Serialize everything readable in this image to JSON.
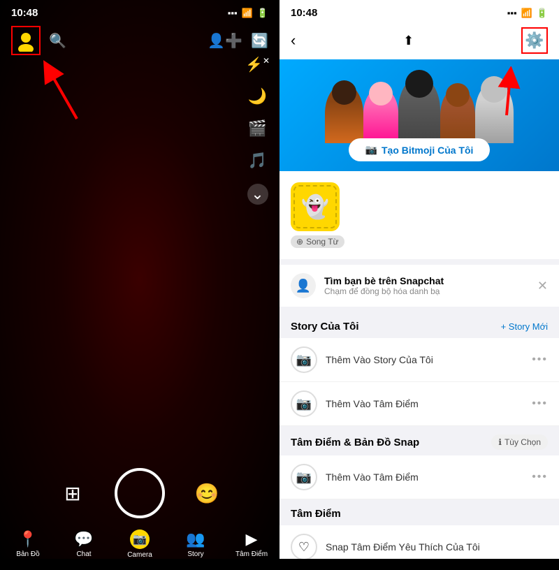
{
  "left": {
    "status_time": "10:48",
    "profile_icon": "👤",
    "top_right_icons": [
      "➕",
      "🔄"
    ],
    "side_icons": [
      "⚡",
      "🌙",
      "🎬",
      "🎵",
      "⌄"
    ],
    "bottom_nav": [
      {
        "label": "Bản Đồ",
        "icon": "📍"
      },
      {
        "label": "Chat",
        "icon": "💬"
      },
      {
        "label": "Camera",
        "icon": "📷",
        "active": true
      },
      {
        "label": "Story",
        "icon": "👥"
      },
      {
        "label": "Tâm Điểm",
        "icon": "▶"
      }
    ]
  },
  "right": {
    "status_time": "10:48",
    "bitmoji_create_btn": "Tạo Bitmoji Của Tôi",
    "username": "Song Từ",
    "find_friends_title": "Tìm bạn bè trên Snapchat",
    "find_friends_sub": "Chạm để đồng bộ hóa danh bạ",
    "story_section_title": "Story Của Tôi",
    "story_new_btn": "+ Story Mới",
    "story_items": [
      {
        "label": "Thêm Vào Story Của Tôi"
      },
      {
        "label": "Thêm Vào Tâm Điểm"
      }
    ],
    "tam_diem_title": "Tâm Điểm & Bản Đồ Snap",
    "tam_diem_option": "Tùy Chọn",
    "tam_diem_items": [
      {
        "label": "Thêm Vào Tâm Điểm"
      }
    ],
    "tam_diem2_title": "Tâm Điểm",
    "snap_yeu_thich": "Snap Tâm Điểm Yêu Thích Của Tôi"
  }
}
